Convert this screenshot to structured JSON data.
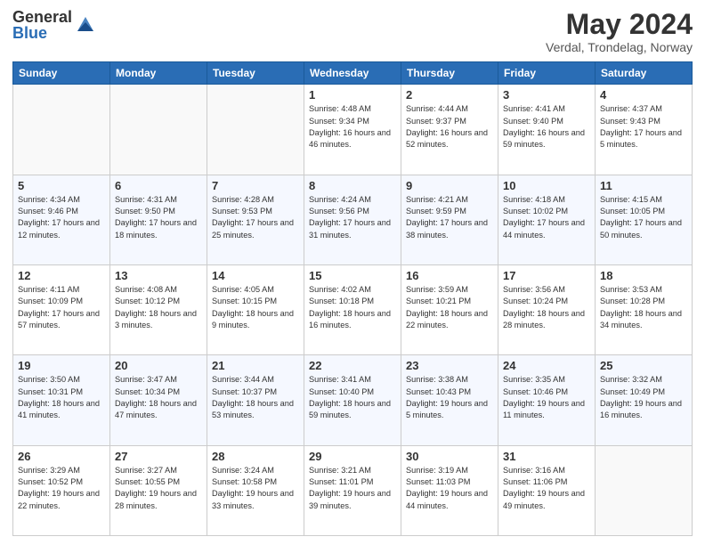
{
  "header": {
    "logo_general": "General",
    "logo_blue": "Blue",
    "month_title": "May 2024",
    "subtitle": "Verdal, Trondelag, Norway"
  },
  "days_of_week": [
    "Sunday",
    "Monday",
    "Tuesday",
    "Wednesday",
    "Thursday",
    "Friday",
    "Saturday"
  ],
  "weeks": [
    [
      {
        "day": "",
        "info": ""
      },
      {
        "day": "",
        "info": ""
      },
      {
        "day": "",
        "info": ""
      },
      {
        "day": "1",
        "info": "Sunrise: 4:48 AM\nSunset: 9:34 PM\nDaylight: 16 hours\nand 46 minutes."
      },
      {
        "day": "2",
        "info": "Sunrise: 4:44 AM\nSunset: 9:37 PM\nDaylight: 16 hours\nand 52 minutes."
      },
      {
        "day": "3",
        "info": "Sunrise: 4:41 AM\nSunset: 9:40 PM\nDaylight: 16 hours\nand 59 minutes."
      },
      {
        "day": "4",
        "info": "Sunrise: 4:37 AM\nSunset: 9:43 PM\nDaylight: 17 hours\nand 5 minutes."
      }
    ],
    [
      {
        "day": "5",
        "info": "Sunrise: 4:34 AM\nSunset: 9:46 PM\nDaylight: 17 hours\nand 12 minutes."
      },
      {
        "day": "6",
        "info": "Sunrise: 4:31 AM\nSunset: 9:50 PM\nDaylight: 17 hours\nand 18 minutes."
      },
      {
        "day": "7",
        "info": "Sunrise: 4:28 AM\nSunset: 9:53 PM\nDaylight: 17 hours\nand 25 minutes."
      },
      {
        "day": "8",
        "info": "Sunrise: 4:24 AM\nSunset: 9:56 PM\nDaylight: 17 hours\nand 31 minutes."
      },
      {
        "day": "9",
        "info": "Sunrise: 4:21 AM\nSunset: 9:59 PM\nDaylight: 17 hours\nand 38 minutes."
      },
      {
        "day": "10",
        "info": "Sunrise: 4:18 AM\nSunset: 10:02 PM\nDaylight: 17 hours\nand 44 minutes."
      },
      {
        "day": "11",
        "info": "Sunrise: 4:15 AM\nSunset: 10:05 PM\nDaylight: 17 hours\nand 50 minutes."
      }
    ],
    [
      {
        "day": "12",
        "info": "Sunrise: 4:11 AM\nSunset: 10:09 PM\nDaylight: 17 hours\nand 57 minutes."
      },
      {
        "day": "13",
        "info": "Sunrise: 4:08 AM\nSunset: 10:12 PM\nDaylight: 18 hours\nand 3 minutes."
      },
      {
        "day": "14",
        "info": "Sunrise: 4:05 AM\nSunset: 10:15 PM\nDaylight: 18 hours\nand 9 minutes."
      },
      {
        "day": "15",
        "info": "Sunrise: 4:02 AM\nSunset: 10:18 PM\nDaylight: 18 hours\nand 16 minutes."
      },
      {
        "day": "16",
        "info": "Sunrise: 3:59 AM\nSunset: 10:21 PM\nDaylight: 18 hours\nand 22 minutes."
      },
      {
        "day": "17",
        "info": "Sunrise: 3:56 AM\nSunset: 10:24 PM\nDaylight: 18 hours\nand 28 minutes."
      },
      {
        "day": "18",
        "info": "Sunrise: 3:53 AM\nSunset: 10:28 PM\nDaylight: 18 hours\nand 34 minutes."
      }
    ],
    [
      {
        "day": "19",
        "info": "Sunrise: 3:50 AM\nSunset: 10:31 PM\nDaylight: 18 hours\nand 41 minutes."
      },
      {
        "day": "20",
        "info": "Sunrise: 3:47 AM\nSunset: 10:34 PM\nDaylight: 18 hours\nand 47 minutes."
      },
      {
        "day": "21",
        "info": "Sunrise: 3:44 AM\nSunset: 10:37 PM\nDaylight: 18 hours\nand 53 minutes."
      },
      {
        "day": "22",
        "info": "Sunrise: 3:41 AM\nSunset: 10:40 PM\nDaylight: 18 hours\nand 59 minutes."
      },
      {
        "day": "23",
        "info": "Sunrise: 3:38 AM\nSunset: 10:43 PM\nDaylight: 19 hours\nand 5 minutes."
      },
      {
        "day": "24",
        "info": "Sunrise: 3:35 AM\nSunset: 10:46 PM\nDaylight: 19 hours\nand 11 minutes."
      },
      {
        "day": "25",
        "info": "Sunrise: 3:32 AM\nSunset: 10:49 PM\nDaylight: 19 hours\nand 16 minutes."
      }
    ],
    [
      {
        "day": "26",
        "info": "Sunrise: 3:29 AM\nSunset: 10:52 PM\nDaylight: 19 hours\nand 22 minutes."
      },
      {
        "day": "27",
        "info": "Sunrise: 3:27 AM\nSunset: 10:55 PM\nDaylight: 19 hours\nand 28 minutes."
      },
      {
        "day": "28",
        "info": "Sunrise: 3:24 AM\nSunset: 10:58 PM\nDaylight: 19 hours\nand 33 minutes."
      },
      {
        "day": "29",
        "info": "Sunrise: 3:21 AM\nSunset: 11:01 PM\nDaylight: 19 hours\nand 39 minutes."
      },
      {
        "day": "30",
        "info": "Sunrise: 3:19 AM\nSunset: 11:03 PM\nDaylight: 19 hours\nand 44 minutes."
      },
      {
        "day": "31",
        "info": "Sunrise: 3:16 AM\nSunset: 11:06 PM\nDaylight: 19 hours\nand 49 minutes."
      },
      {
        "day": "",
        "info": ""
      }
    ]
  ]
}
